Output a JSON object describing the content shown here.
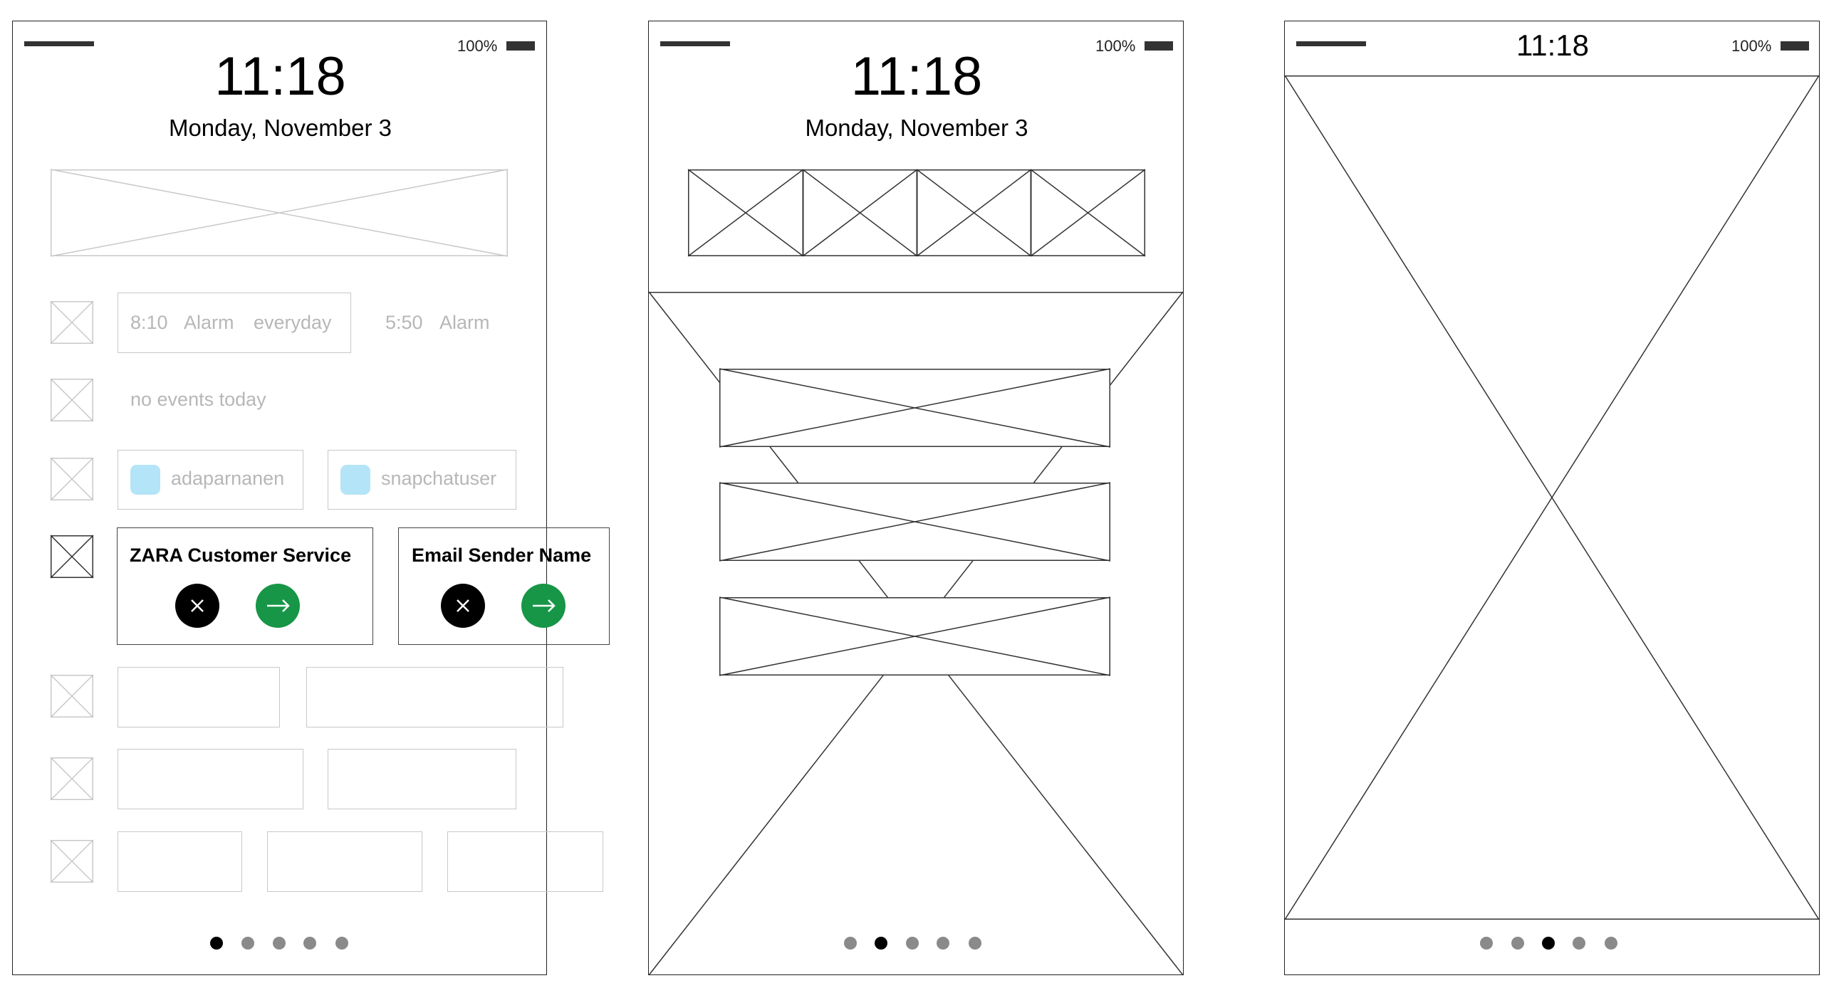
{
  "colors": {
    "accent_green": "#179647",
    "chip_blue": "#b4e4f7",
    "faded_text": "#b7b7b7"
  },
  "screens": [
    {
      "battery": "100%",
      "time": "11:18",
      "date": "Monday, November 3",
      "alarms": [
        {
          "time": "8:10",
          "label": "Alarm",
          "repeat": "everyday"
        },
        {
          "time": "5:50",
          "label": "Alarm"
        }
      ],
      "no_events": "no events today",
      "contacts": [
        "adaparnanen",
        "snapchatuser"
      ],
      "notifications": [
        {
          "title": "ZARA Customer Service",
          "dismiss_icon": "close-icon",
          "open_icon": "arrow-right-icon"
        },
        {
          "title": "Email Sender Name",
          "dismiss_icon": "close-icon",
          "open_icon": "arrow-right-icon"
        }
      ],
      "page_indicator": {
        "count": 5,
        "active": 1
      }
    },
    {
      "battery": "100%",
      "time": "11:18",
      "date": "Monday, November 3",
      "page_indicator": {
        "count": 5,
        "active": 2
      }
    },
    {
      "battery": "100%",
      "time": "11:18",
      "page_indicator": {
        "count": 5,
        "active": 3
      }
    }
  ]
}
